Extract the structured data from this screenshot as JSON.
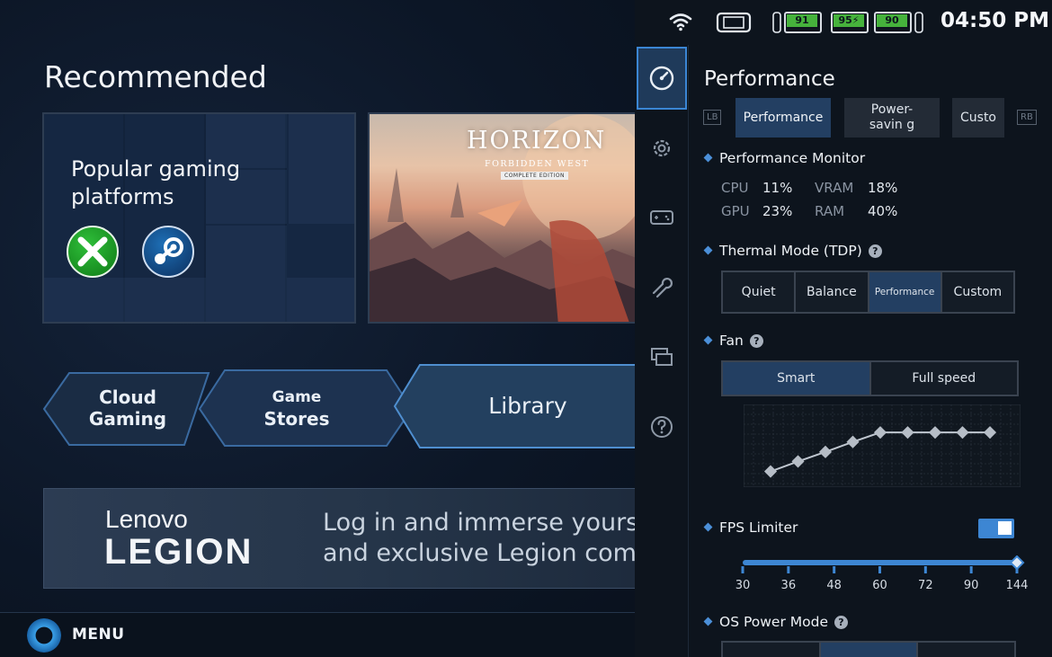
{
  "launcher": {
    "recommended_title": "Recommended",
    "platforms_card": {
      "label": "Popular gaming platforms",
      "xbox_icon": "xbox-logo-icon",
      "steam_icon": "steam-logo-icon"
    },
    "horizon_card": {
      "title": "HORIZON",
      "subtitle": "FORBIDDEN WEST",
      "edition": "COMPLETE EDITION"
    },
    "nav": {
      "cloud_line1": "Cloud",
      "cloud_line2": "Gaming",
      "stores_line1": "Game",
      "stores_line2": "Stores",
      "library": "Library"
    },
    "banner": {
      "lenovo": "Lenovo",
      "legion": "LEGION",
      "line1": "Log in and immerse yourself",
      "line2": "and exclusive Legion commu"
    },
    "menu_label": "MENU"
  },
  "status": {
    "clock": "04:50 PM",
    "batteries": [
      {
        "value": "91",
        "charging": false
      },
      {
        "value": "95",
        "charging": true
      },
      {
        "value": "90",
        "charging": false
      }
    ],
    "icons": [
      "wifi-icon",
      "handheld-icon",
      "controller-left-battery",
      "controller-right-battery"
    ]
  },
  "sidebar": [
    "performance-gauge-icon",
    "settings-gear-icon",
    "controller-icon",
    "wrench-icon",
    "display-icon",
    "help-icon"
  ],
  "performance": {
    "title": "Performance",
    "lb": "LB",
    "rb": "RB",
    "mode_tabs": [
      "Performance",
      "Power-savin g",
      "Custo"
    ],
    "monitor": {
      "title": "Performance Monitor",
      "cpu_label": "CPU",
      "cpu_value": "11%",
      "vram_label": "VRAM",
      "vram_value": "18%",
      "gpu_label": "GPU",
      "gpu_value": "23%",
      "ram_label": "RAM",
      "ram_value": "40%"
    },
    "thermal": {
      "title": "Thermal Mode (TDP)",
      "options": [
        "Quiet",
        "Balance",
        "Performance",
        "Custom"
      ],
      "selected": "Performance"
    },
    "fan": {
      "title": "Fan",
      "options": [
        "Smart",
        "Full speed"
      ],
      "selected": "Smart",
      "curve_levels": [
        0.12,
        0.3,
        0.47,
        0.65,
        0.82,
        0.82,
        0.82,
        0.82,
        0.82
      ]
    },
    "fps": {
      "title": "FPS Limiter",
      "enabled": true,
      "ticks": [
        "30",
        "36",
        "48",
        "60",
        "72",
        "90",
        "144"
      ],
      "value": "144"
    },
    "os_power": {
      "title": "OS Power Mode"
    }
  },
  "colors": {
    "accent": "#3b86d4",
    "selected_bg": "#233f62",
    "battery_green": "#46b23c"
  }
}
